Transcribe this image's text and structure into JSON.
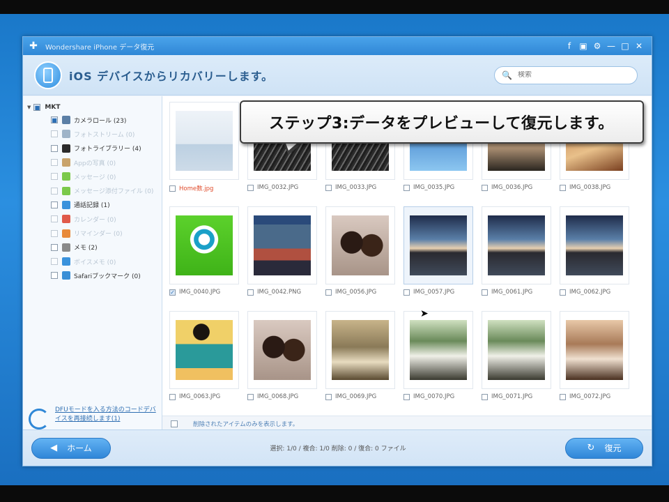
{
  "window": {
    "title": "Wondershare iPhone データ復元",
    "icons": [
      "facebook-icon",
      "feedback-icon",
      "settings-icon",
      "minimize-icon",
      "maximize-icon",
      "close-icon"
    ]
  },
  "header": {
    "title": "iOS デバイスからリカバリーします。",
    "search_placeholder": "検索"
  },
  "callout": {
    "text": "ステップ3:データをプレビューして復元します。"
  },
  "sidebar": {
    "root": "MKT",
    "items": [
      {
        "label": "カメラロール (23)",
        "color": "#5b7fa6",
        "checked": true,
        "dim": false
      },
      {
        "label": "フォトストリーム (0)",
        "color": "#9fb4c8",
        "checked": false,
        "dim": true
      },
      {
        "label": "フォトライブラリー (4)",
        "color": "#2b2b2b",
        "checked": false,
        "dim": false
      },
      {
        "label": "Appの写真 (0)",
        "color": "#c9a36b",
        "checked": false,
        "dim": true
      },
      {
        "label": "メッセージ (0)",
        "color": "#7bc94a",
        "checked": false,
        "dim": true
      },
      {
        "label": "メッセージ添付ファイル (0)",
        "color": "#7bc94a",
        "checked": false,
        "dim": true
      },
      {
        "label": "通話記録 (1)",
        "color": "#3a92dc",
        "checked": false,
        "dim": false
      },
      {
        "label": "カレンダー (0)",
        "color": "#e05a4a",
        "checked": false,
        "dim": true
      },
      {
        "label": "リマインダー (0)",
        "color": "#e88a3a",
        "checked": false,
        "dim": true
      },
      {
        "label": "メモ (2)",
        "color": "#8a8a8a",
        "checked": false,
        "dim": false
      },
      {
        "label": "ボイスメモ (0)",
        "color": "#3a92dc",
        "checked": false,
        "dim": true
      },
      {
        "label": "Safariブックマーク (0)",
        "color": "#3a8fd6",
        "checked": false,
        "dim": false
      }
    ],
    "footer_link": "DFUモードを入る方法のコードデバイスを再接続します(1)"
  },
  "grid": {
    "items": [
      {
        "label": "Home数.jpg",
        "img": "placeholder",
        "red": true,
        "checked": false
      },
      {
        "label": "IMG_0032.JPG",
        "img": "dark",
        "red": false,
        "checked": false
      },
      {
        "label": "IMG_0033.JPG",
        "img": "dark",
        "red": false,
        "checked": false
      },
      {
        "label": "IMG_0035.JPG",
        "img": "blue-person",
        "red": false,
        "checked": false
      },
      {
        "label": "IMG_0036.JPG",
        "img": "sunset",
        "red": false,
        "checked": false
      },
      {
        "label": "IMG_0038.JPG",
        "img": "warm",
        "red": false,
        "checked": false
      },
      {
        "label": "IMG_0040.JPG",
        "img": "monster",
        "red": false,
        "checked": true
      },
      {
        "label": "IMG_0042.PNG",
        "img": "screenshot",
        "red": false,
        "checked": false
      },
      {
        "label": "IMG_0056.JPG",
        "img": "selfie",
        "red": false,
        "checked": false
      },
      {
        "label": "IMG_0057.JPG",
        "img": "sea",
        "red": false,
        "checked": false,
        "selected": true
      },
      {
        "label": "IMG_0061.JPG",
        "img": "sea",
        "red": false,
        "checked": false
      },
      {
        "label": "IMG_0062.JPG",
        "img": "sea",
        "red": false,
        "checked": false
      },
      {
        "label": "IMG_0063.JPG",
        "img": "teal-girl",
        "red": false,
        "checked": false
      },
      {
        "label": "IMG_0068.JPG",
        "img": "selfie",
        "red": false,
        "checked": false
      },
      {
        "label": "IMG_0069.JPG",
        "img": "beige",
        "red": false,
        "checked": false
      },
      {
        "label": "IMG_0070.JPG",
        "img": "green-room",
        "red": false,
        "checked": false
      },
      {
        "label": "IMG_0071.JPG",
        "img": "green-room",
        "red": false,
        "checked": false
      },
      {
        "label": "IMG_0072.JPG",
        "img": "sepia",
        "red": false,
        "checked": false
      }
    ]
  },
  "status_strip": {
    "text": "削除されたアイテムのみを表示します。"
  },
  "footer": {
    "home_label": "ホーム",
    "summary": "選択: 1/0 / 複合: 1/0 削除: 0 / 復合: 0 ファイル",
    "recover_label": "復元"
  }
}
